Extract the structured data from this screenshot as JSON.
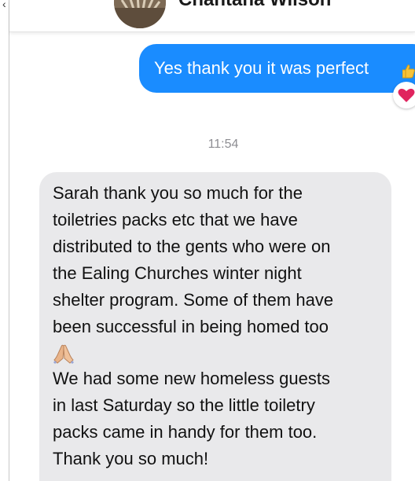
{
  "header": {
    "contact_name": "Chantana Wilson",
    "back_icon": "chevron-left-icon",
    "avatar_icon": "contact-avatar"
  },
  "outgoing_message": {
    "text": "Yes thank you it was perfect",
    "trailing_emoji": "thumbs-up-emoji",
    "reaction": "heart-reaction-icon",
    "color": "#1a8cff"
  },
  "timestamp": "11:54",
  "incoming_message": {
    "lines": [
      "Sarah thank you so much for the",
      "toiletries packs etc that we have",
      "distributed to the gents who were on",
      "the Ealing Churches winter night",
      "shelter program. Some of them have",
      "been successful in being homed too"
    ],
    "emoji": "praying-hands-emoji",
    "lines_after": [
      "We had some new homeless guests",
      "in last Saturday so the little toiletry",
      "packs came in handy for them too.",
      "Thank you so much!"
    ],
    "color": "#e9e9eb"
  }
}
